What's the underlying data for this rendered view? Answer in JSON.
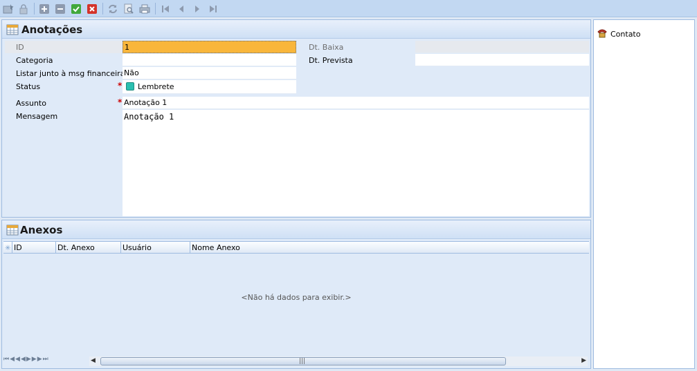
{
  "toolbar": {
    "icons": [
      "new-record-icon",
      "lock-icon",
      "add-icon",
      "remove-icon",
      "confirm-icon",
      "cancel-icon",
      "refresh-icon",
      "preview-icon",
      "print-icon",
      "first-icon",
      "prev-icon",
      "next-icon",
      "last-icon"
    ]
  },
  "anotacoes": {
    "title": "Anotações",
    "fields": {
      "id_label": "ID",
      "id_value": "1",
      "categoria_label": "Categoria",
      "categoria_value": "",
      "listar_label": "Listar junto à msg financeira",
      "listar_value": "Não",
      "status_label": "Status",
      "status_value": "Lembrete",
      "assunto_label": "Assunto",
      "assunto_value": "Anotação 1",
      "mensagem_label": "Mensagem",
      "mensagem_value": "Anotação 1",
      "dt_baixa_label": "Dt. Baixa",
      "dt_baixa_value": "",
      "dt_prevista_label": "Dt. Prevista",
      "dt_prevista_value": ""
    },
    "required_mark": "*"
  },
  "anexos": {
    "title": "Anexos",
    "columns": [
      "ID",
      "Dt. Anexo",
      "Usuário",
      "Nome Anexo"
    ],
    "empty_text": "<Não há dados para exibir.>"
  },
  "side": {
    "contato_label": "Contato"
  },
  "colors": {
    "accent": "#c2d8f2",
    "status_color": "#2bbfb0",
    "active_field": "#f9b63b"
  }
}
